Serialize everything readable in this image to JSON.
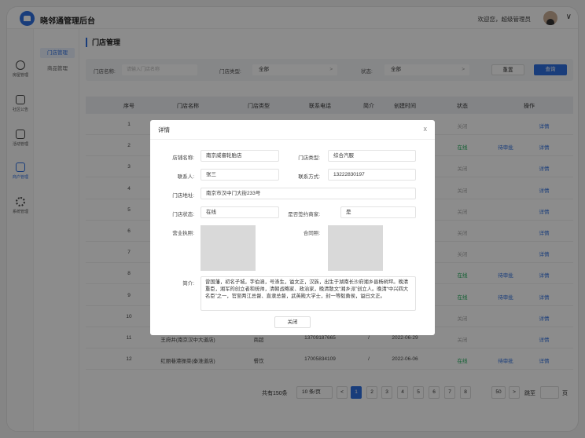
{
  "app": {
    "title": "晓邻通管理后台",
    "welcome": "欢迎您，超级管理员",
    "user_chevron": "∨"
  },
  "rail": [
    {
      "label": "房屋管理",
      "icon": "house-icon"
    },
    {
      "label": "社区公告",
      "icon": "notice-icon"
    },
    {
      "label": "活动管理",
      "icon": "activity-icon"
    },
    {
      "label": "商户管理",
      "icon": "shop-icon",
      "active": true
    },
    {
      "label": "系统管理",
      "icon": "gear-icon"
    }
  ],
  "subnav": {
    "store_manage": "门店管理",
    "goods_manage": "商品管理"
  },
  "page": {
    "title": "门店管理"
  },
  "filter": {
    "name_label": "门店名称:",
    "name_placeholder": "请输入门店名称",
    "type_label": "门店类型:",
    "type_value": "全部",
    "status_label": "状态:",
    "status_value": "全部",
    "chev": ">",
    "reset_label": "重置",
    "search_label": "查询"
  },
  "table": {
    "headers": [
      "序号",
      "门店名称",
      "门店类型",
      "联系电话",
      "简介",
      "创建时间",
      "状态",
      "操作"
    ],
    "rows": [
      {
        "no": "1",
        "status": "关闭",
        "status_type": "closed",
        "approve": "",
        "detail": "详情"
      },
      {
        "no": "2",
        "status": "在线",
        "status_type": "online",
        "approve": "待审批",
        "detail": "详情"
      },
      {
        "no": "3",
        "status": "关闭",
        "status_type": "closed",
        "approve": "",
        "detail": "详情"
      },
      {
        "no": "4",
        "status": "关闭",
        "status_type": "closed",
        "approve": "",
        "detail": "详情"
      },
      {
        "no": "5",
        "status": "关闭",
        "status_type": "closed",
        "approve": "",
        "detail": "详情"
      },
      {
        "no": "6",
        "status": "关闭",
        "status_type": "closed",
        "approve": "",
        "detail": "详情"
      },
      {
        "no": "7",
        "status": "关闭",
        "status_type": "closed",
        "approve": "",
        "detail": "详情"
      },
      {
        "no": "8",
        "status": "在线",
        "status_type": "online",
        "approve": "待审批",
        "detail": "详情"
      },
      {
        "no": "9",
        "status": "在线",
        "status_type": "online",
        "approve": "待审批",
        "detail": "详情"
      },
      {
        "no": "10",
        "status": "关闭",
        "status_type": "closed",
        "approve": "",
        "detail": "详情"
      },
      {
        "no": "11",
        "name": "王府井(南京汉中大道店)",
        "type": "商超",
        "phone": "13709187665",
        "intro": "/",
        "created": "2022-06-29",
        "status": "关闭",
        "status_type": "closed",
        "approve": "",
        "detail": "详情"
      },
      {
        "no": "12",
        "name": "红丽巷港操菜(秦淮道店)",
        "type": "餐饮",
        "phone": "17005834109",
        "intro": "/",
        "created": "2022-06-06",
        "status": "在线",
        "status_type": "online",
        "approve": "待审批",
        "detail": "详情"
      }
    ]
  },
  "pager": {
    "total": "共有150条",
    "page_size": "10 条/页",
    "prev": "<",
    "next": ">",
    "pages": [
      "1",
      "2",
      "3",
      "4",
      "5",
      "6",
      "7",
      "8"
    ],
    "ellipsis": "···",
    "last": "50",
    "jump_label": "跳至",
    "jump_unit": "页"
  },
  "modal": {
    "title": "详情",
    "close_glyph": "x",
    "store_name_label": "店铺名称:",
    "store_name": "南京威睿轮胎店",
    "store_type_label": "门店类型:",
    "store_type": "综合汽服",
    "contact_label": "联系人:",
    "contact": "张三",
    "phone_label": "联系方式:",
    "phone": "13222830197",
    "address_label": "门店地址:",
    "address": "南京市汉中门大街233号",
    "status_label": "门店状态:",
    "status": "在线",
    "signed_label": "是否签约商家:",
    "signed": "是",
    "license_label": "营业执照:",
    "contract_label": "合同照:",
    "intro_label": "简介:",
    "intro": "曾国藩，初名子城，字伯涵，号涤生，谥文正，汉族，出生于湖南长沙府湘乡县杨树坪。晚清重臣，湘军的创立者和统帅，清朝战略家、政治家，晚清散文“湘乡派”创立人。晚清“中兴四大名臣”之一，官至两江总督、直隶总督，武英殿大学士，封一等毅勇侯，谥曰文正。",
    "close_button": "关闭"
  }
}
